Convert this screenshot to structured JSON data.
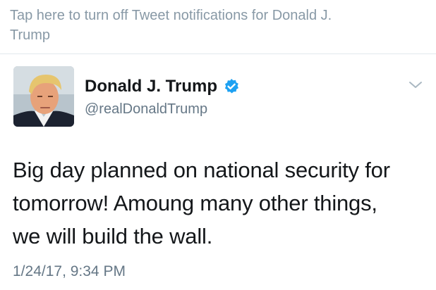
{
  "notification": {
    "line1": "Tap here to turn off Tweet notifications for Donald J.",
    "line2": "Trump"
  },
  "author": {
    "name": "Donald J. Trump",
    "handle": "@realDonaldTrump",
    "verified": true
  },
  "tweet": {
    "lines": [
      "Big day planned on national security for",
      "tomorrow! Amoung many other things,",
      "we will build the wall."
    ],
    "timestamp": "1/24/17, 9:34 PM"
  },
  "icons": {
    "verified": "verified-badge-icon",
    "menu": "chevron-down-icon"
  },
  "colors": {
    "verified_blue": "#1da1f2",
    "text_primary": "#14171a",
    "text_secondary": "#657786",
    "notification_gray": "#8899a6"
  }
}
